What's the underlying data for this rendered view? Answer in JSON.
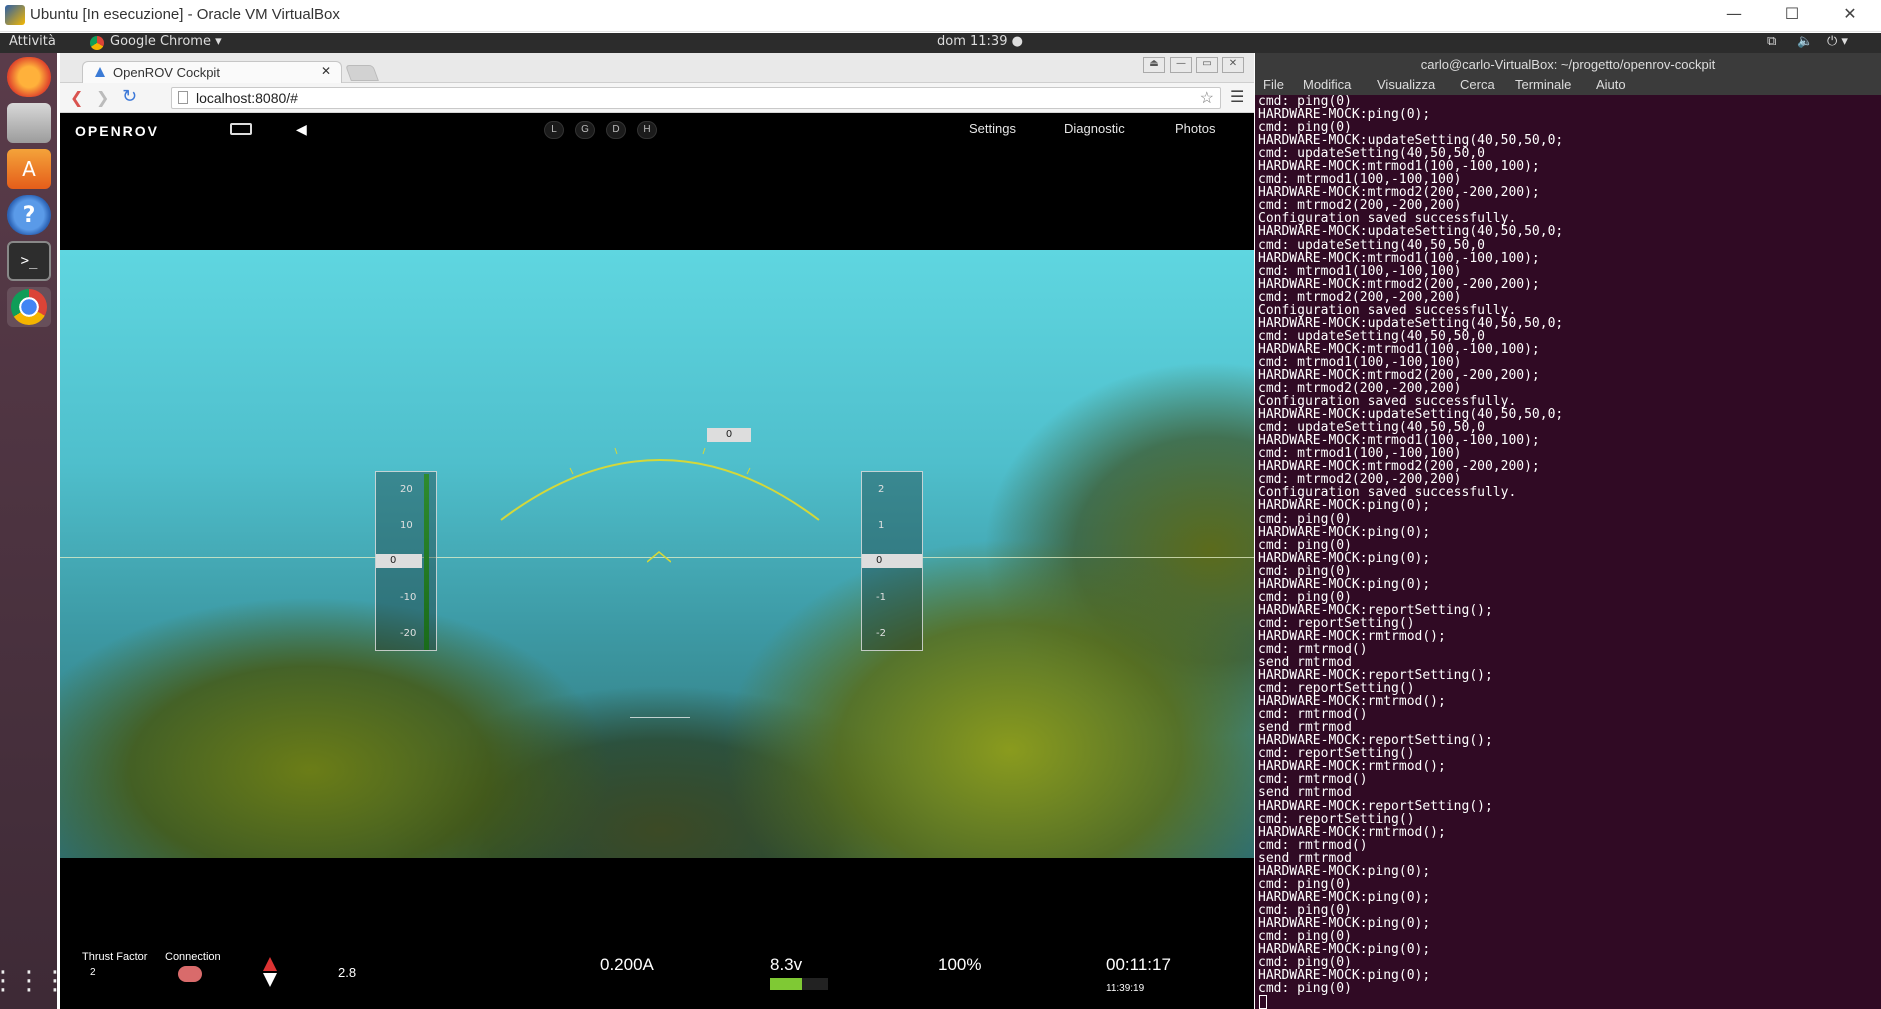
{
  "window": {
    "title": "Ubuntu [In esecuzione] - Oracle VM VirtualBox"
  },
  "topbar": {
    "activities": "Attività",
    "app": "Google Chrome",
    "clock": "dom 11:39"
  },
  "dock": {
    "items": [
      "firefox-icon",
      "files-icon",
      "software-center-icon",
      "help-icon",
      "terminal-icon",
      "chrome-icon"
    ],
    "apps_grid": "show-applications-icon"
  },
  "chrome": {
    "tab_title": "OpenROV Cockpit",
    "url": "localhost:8080/#"
  },
  "rov": {
    "logo": "OPENROV",
    "lamps": [
      "L",
      "G",
      "D",
      "H"
    ],
    "nav": [
      "Settings",
      "Diagnostic",
      "Photos"
    ],
    "depth_tape": {
      "ticks": [
        "20",
        "10",
        "0",
        "-10",
        "-20"
      ],
      "value": "0"
    },
    "pitch_tape": {
      "ticks": [
        "2",
        "1",
        "0",
        "-1",
        "-2"
      ],
      "value": "0"
    },
    "heading": "0",
    "thrust_factor_label": "Thrust Factor",
    "thrust_factor_value": "2",
    "connection_label": "Connection",
    "depth_reading": "2.8",
    "current": "0.200A",
    "voltage": "8.3v",
    "battery_level": 0.55,
    "cpu": "100%",
    "timer": "00:11:17",
    "clock": "11:39:19"
  },
  "terminal": {
    "title": "carlo@carlo-VirtualBox: ~/progetto/openrov-cockpit",
    "menu": [
      "File",
      "Modifica",
      "Visualizza",
      "Cerca",
      "Terminale",
      "Aiuto"
    ],
    "lines": "cmd: ping(0)\nHARDWARE-MOCK:ping(0);\ncmd: ping(0)\nHARDWARE-MOCK:updateSetting(40,50,50,0;\ncmd: updateSetting(40,50,50,0\nHARDWARE-MOCK:mtrmod1(100,-100,100);\ncmd: mtrmod1(100,-100,100)\nHARDWARE-MOCK:mtrmod2(200,-200,200);\ncmd: mtrmod2(200,-200,200)\nConfiguration saved successfully.\nHARDWARE-MOCK:updateSetting(40,50,50,0;\ncmd: updateSetting(40,50,50,0\nHARDWARE-MOCK:mtrmod1(100,-100,100);\ncmd: mtrmod1(100,-100,100)\nHARDWARE-MOCK:mtrmod2(200,-200,200);\ncmd: mtrmod2(200,-200,200)\nConfiguration saved successfully.\nHARDWARE-MOCK:updateSetting(40,50,50,0;\ncmd: updateSetting(40,50,50,0\nHARDWARE-MOCK:mtrmod1(100,-100,100);\ncmd: mtrmod1(100,-100,100)\nHARDWARE-MOCK:mtrmod2(200,-200,200);\ncmd: mtrmod2(200,-200,200)\nConfiguration saved successfully.\nHARDWARE-MOCK:updateSetting(40,50,50,0;\ncmd: updateSetting(40,50,50,0\nHARDWARE-MOCK:mtrmod1(100,-100,100);\ncmd: mtrmod1(100,-100,100)\nHARDWARE-MOCK:mtrmod2(200,-200,200);\ncmd: mtrmod2(200,-200,200)\nConfiguration saved successfully.\nHARDWARE-MOCK:ping(0);\ncmd: ping(0)\nHARDWARE-MOCK:ping(0);\ncmd: ping(0)\nHARDWARE-MOCK:ping(0);\ncmd: ping(0)\nHARDWARE-MOCK:ping(0);\ncmd: ping(0)\nHARDWARE-MOCK:reportSetting();\ncmd: reportSetting()\nHARDWARE-MOCK:rmtrmod();\ncmd: rmtrmod()\nsend rmtrmod\nHARDWARE-MOCK:reportSetting();\ncmd: reportSetting()\nHARDWARE-MOCK:rmtrmod();\ncmd: rmtrmod()\nsend rmtrmod\nHARDWARE-MOCK:reportSetting();\ncmd: reportSetting()\nHARDWARE-MOCK:rmtrmod();\ncmd: rmtrmod()\nsend rmtrmod\nHARDWARE-MOCK:reportSetting();\ncmd: reportSetting()\nHARDWARE-MOCK:rmtrmod();\ncmd: rmtrmod()\nsend rmtrmod\nHARDWARE-MOCK:ping(0);\ncmd: ping(0)\nHARDWARE-MOCK:ping(0);\ncmd: ping(0)\nHARDWARE-MOCK:ping(0);\ncmd: ping(0)\nHARDWARE-MOCK:ping(0);\ncmd: ping(0)\nHARDWARE-MOCK:ping(0);\ncmd: ping(0)"
  }
}
